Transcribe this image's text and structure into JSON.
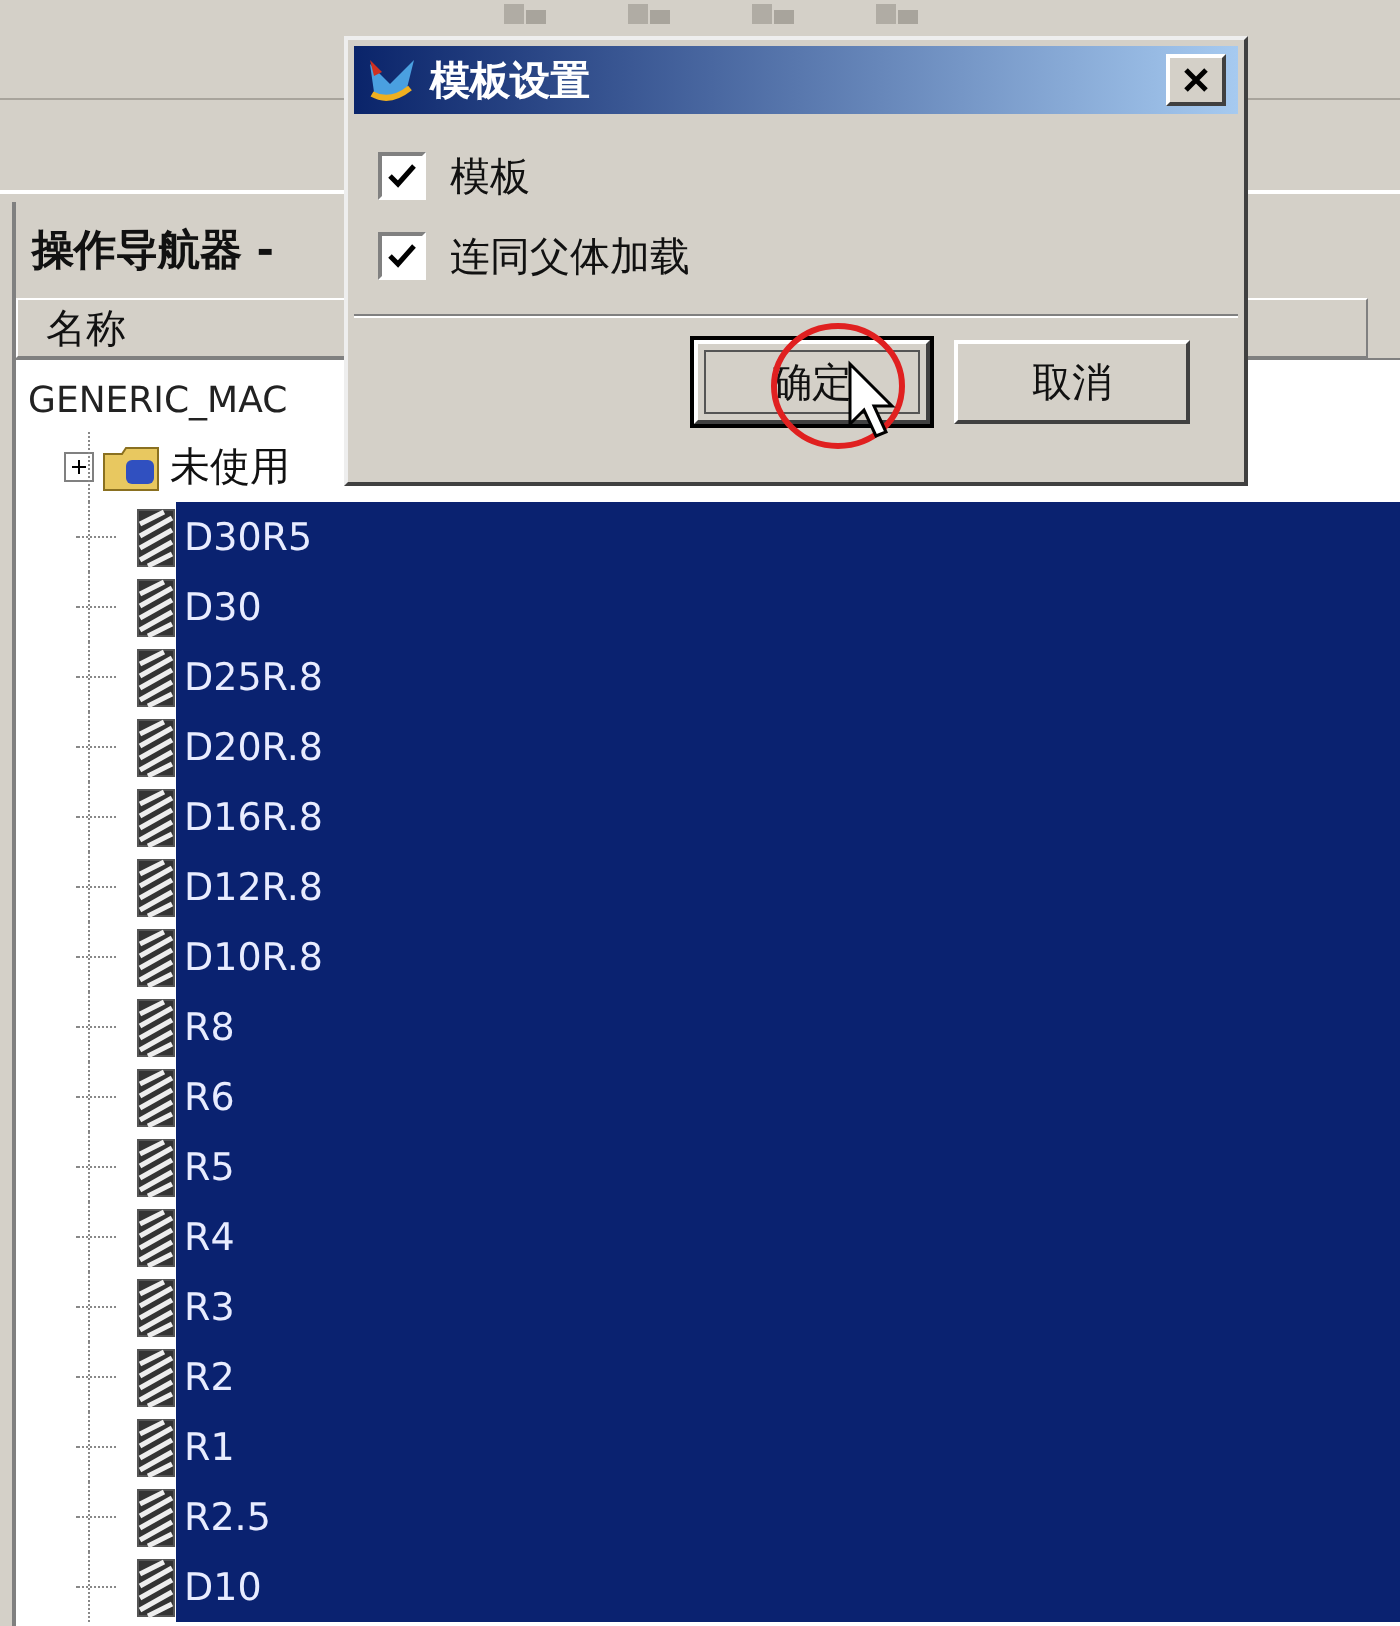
{
  "navigator": {
    "title": "操作导航器 -",
    "columns": [
      "名称"
    ],
    "root": {
      "label": "GENERIC_MAC",
      "children": [
        {
          "label": "未使用",
          "kind": "group",
          "expanded": false,
          "selected": false
        },
        {
          "label": "D30R5",
          "kind": "tool",
          "selected": true
        },
        {
          "label": "D30",
          "kind": "tool",
          "selected": true
        },
        {
          "label": "D25R.8",
          "kind": "tool",
          "selected": true
        },
        {
          "label": "D20R.8",
          "kind": "tool",
          "selected": true
        },
        {
          "label": "D16R.8",
          "kind": "tool",
          "selected": true
        },
        {
          "label": "D12R.8",
          "kind": "tool",
          "selected": true
        },
        {
          "label": "D10R.8",
          "kind": "tool",
          "selected": true
        },
        {
          "label": "R8",
          "kind": "tool",
          "selected": true
        },
        {
          "label": "R6",
          "kind": "tool",
          "selected": true
        },
        {
          "label": "R5",
          "kind": "tool",
          "selected": true
        },
        {
          "label": "R4",
          "kind": "tool",
          "selected": true
        },
        {
          "label": "R3",
          "kind": "tool",
          "selected": true
        },
        {
          "label": "R2",
          "kind": "tool",
          "selected": true
        },
        {
          "label": "R1",
          "kind": "tool",
          "selected": true
        },
        {
          "label": "R2.5",
          "kind": "tool",
          "selected": true
        },
        {
          "label": "D10",
          "kind": "tool",
          "selected": true
        }
      ]
    }
  },
  "dialog": {
    "title": "模板设置",
    "options": [
      {
        "label": "模板",
        "checked": true
      },
      {
        "label": "连同父体加载",
        "checked": true
      }
    ],
    "buttons": [
      {
        "label": "确定",
        "focused": true
      },
      {
        "label": "取消",
        "focused": false
      }
    ]
  }
}
